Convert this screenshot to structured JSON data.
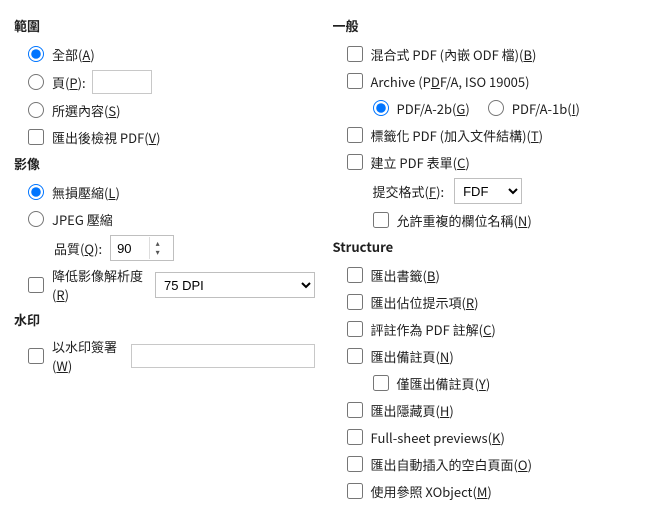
{
  "range": {
    "title": "範圍",
    "all_pre": "全部(",
    "all_key": "A",
    "all_post": ")",
    "pages_pre": "頁(",
    "pages_key": "P",
    "pages_post": "):",
    "pages_value": "",
    "selection_pre": "所選內容(",
    "selection_key": "S",
    "selection_post": ")",
    "viewafter_pre": "匯出後檢視 PDF(",
    "viewafter_key": "V",
    "viewafter_post": ")"
  },
  "image": {
    "title": "影像",
    "lossless_pre": "無損壓縮(",
    "lossless_key": "L",
    "lossless_post": ")",
    "jpeg": "JPEG 壓縮",
    "quality_pre": "品質(",
    "quality_key": "Q",
    "quality_post": "):",
    "quality_value": "90",
    "reduce_pre": "降低影像解析度(",
    "reduce_key": "R",
    "reduce_post": ")",
    "dpi_options": [
      "75 DPI"
    ]
  },
  "watermark": {
    "title": "水印",
    "sign_pre": "以水印簽署(",
    "sign_key": "W",
    "sign_post": ")",
    "value": ""
  },
  "general": {
    "title": "一般",
    "hybrid_pre": "混合式 PDF (內嵌 ODF 檔)(",
    "hybrid_key": "B",
    "hybrid_post": ")",
    "archive_pre": "Archive (P",
    "archive_key": "D",
    "archive_post": "F/A, ISO 19005)",
    "pdfa2b_pre": "PDF/A-2b(",
    "pdfa2b_key": "G",
    "pdfa2b_post": ")",
    "pdfa1b_pre": "PDF/A-1b(",
    "pdfa1b_key": "I",
    "pdfa1b_post": ")",
    "tagged_pre": "標籤化 PDF (加入文件結構)(",
    "tagged_key": "T",
    "tagged_post": ")",
    "form_pre": "建立 PDF 表單(",
    "form_key": "C",
    "form_post": ")",
    "submit_pre": "提交格式(",
    "submit_key": "F",
    "submit_post": "):",
    "submit_options": [
      "FDF"
    ],
    "dup_pre": "允許重複的欄位名稱(",
    "dup_key": "N",
    "dup_post": ")"
  },
  "structure": {
    "title": "Structure",
    "bookmarks_pre": "匯出書籤(",
    "bookmarks_key": "B",
    "bookmarks_post": ")",
    "placeholders_pre": "匯出佔位提示項(",
    "placeholders_key": "R",
    "placeholders_post": ")",
    "comments_pre": "評註作為 PDF 註解(",
    "comments_key": "C",
    "comments_post": ")",
    "notes_pre": "匯出備註頁(",
    "notes_key": "N",
    "notes_post": ")",
    "onlynotes_pre": "僅匯出備註頁(",
    "onlynotes_key": "Y",
    "onlynotes_post": ")",
    "hidden_pre": "匯出隱藏頁(",
    "hidden_key": "H",
    "hidden_post": ")",
    "fullsheet_pre": "Full-sheet previews(",
    "fullsheet_key": "K",
    "fullsheet_post": ")",
    "autoblank_pre": "匯出自動插入的空白頁面(",
    "autoblank_key": "O",
    "autoblank_post": ")",
    "xobject_pre": "使用參照 XObject(",
    "xobject_key": "M",
    "xobject_post": ")"
  }
}
